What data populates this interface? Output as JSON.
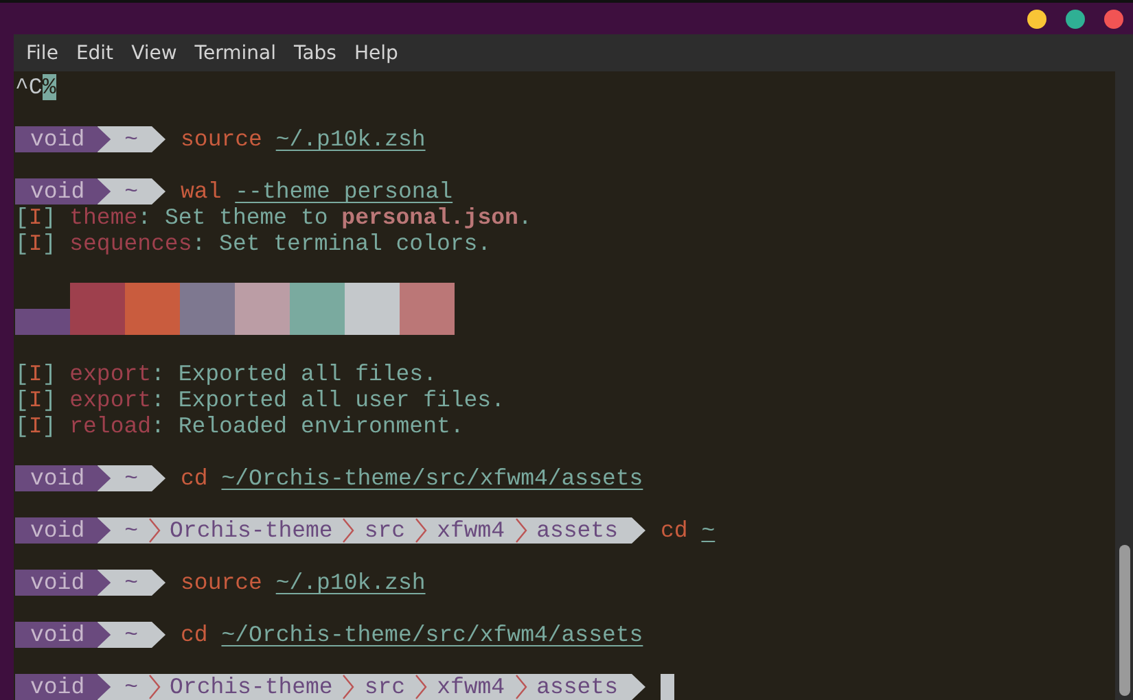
{
  "window": {
    "controls": [
      {
        "kind": "minimize"
      },
      {
        "kind": "maximize"
      },
      {
        "kind": "close"
      }
    ]
  },
  "menu": [
    "File",
    "Edit",
    "View",
    "Terminal",
    "Tabs",
    "Help"
  ],
  "lines": [
    {
      "kind": "interrupt",
      "text": "^C",
      "marker": "%"
    },
    {
      "kind": "blank"
    },
    {
      "kind": "prompt",
      "user": "void",
      "path": [
        "~"
      ],
      "command": "source",
      "argument": "~/.p10k.zsh",
      "cursor": false
    },
    {
      "kind": "blank"
    },
    {
      "kind": "prompt",
      "user": "void",
      "path": [
        "~"
      ],
      "command": "wal",
      "argument": "--theme personal",
      "cursor": false
    },
    {
      "kind": "log",
      "tag_open": "[",
      "tag": "I",
      "tag_close": "]",
      "key": "theme",
      "message": ": Set theme to **personal.json**."
    },
    {
      "kind": "log",
      "tag_open": "[",
      "tag": "I",
      "tag_close": "]",
      "key": "sequences",
      "message": ": Set terminal colors."
    },
    {
      "kind": "blank"
    },
    {
      "kind": "palette",
      "colors": [
        {
          "color": "#6a4a7e",
          "short": true
        },
        {
          "color": "#9e404d",
          "short": false
        },
        {
          "color": "#c95c3e",
          "short": false
        },
        {
          "color": "#7e7890",
          "short": false
        },
        {
          "color": "#bb9da5",
          "short": false
        },
        {
          "color": "#7aaa9f",
          "short": false
        },
        {
          "color": "#c4c8cb",
          "short": false
        },
        {
          "color": "#bb7777",
          "short": false
        }
      ]
    },
    {
      "kind": "blank"
    },
    {
      "kind": "log",
      "tag_open": "[",
      "tag": "I",
      "tag_close": "]",
      "key": "export",
      "message": ": Exported all files."
    },
    {
      "kind": "log",
      "tag_open": "[",
      "tag": "I",
      "tag_close": "]",
      "key": "export",
      "message": ": Exported all user files."
    },
    {
      "kind": "log",
      "tag_open": "[",
      "tag": "I",
      "tag_close": "]",
      "key": "reload",
      "message": ": Reloaded environment."
    },
    {
      "kind": "blank"
    },
    {
      "kind": "prompt",
      "user": "void",
      "path": [
        "~"
      ],
      "command": "cd",
      "argument": "~/Orchis-theme/src/xfwm4/assets",
      "cursor": false
    },
    {
      "kind": "blank"
    },
    {
      "kind": "prompt",
      "user": "void",
      "path": [
        "~",
        "Orchis-theme",
        "src",
        "xfwm4",
        "assets"
      ],
      "command": "cd",
      "argument": "~",
      "cursor": false
    },
    {
      "kind": "blank"
    },
    {
      "kind": "prompt",
      "user": "void",
      "path": [
        "~"
      ],
      "command": "source",
      "argument": "~/.p10k.zsh",
      "cursor": false
    },
    {
      "kind": "blank"
    },
    {
      "kind": "prompt",
      "user": "void",
      "path": [
        "~"
      ],
      "command": "cd",
      "argument": "~/Orchis-theme/src/xfwm4/assets",
      "cursor": false
    },
    {
      "kind": "blank"
    },
    {
      "kind": "prompt",
      "user": "void",
      "path": [
        "~",
        "Orchis-theme",
        "src",
        "xfwm4",
        "assets"
      ],
      "cursor": true
    }
  ]
}
